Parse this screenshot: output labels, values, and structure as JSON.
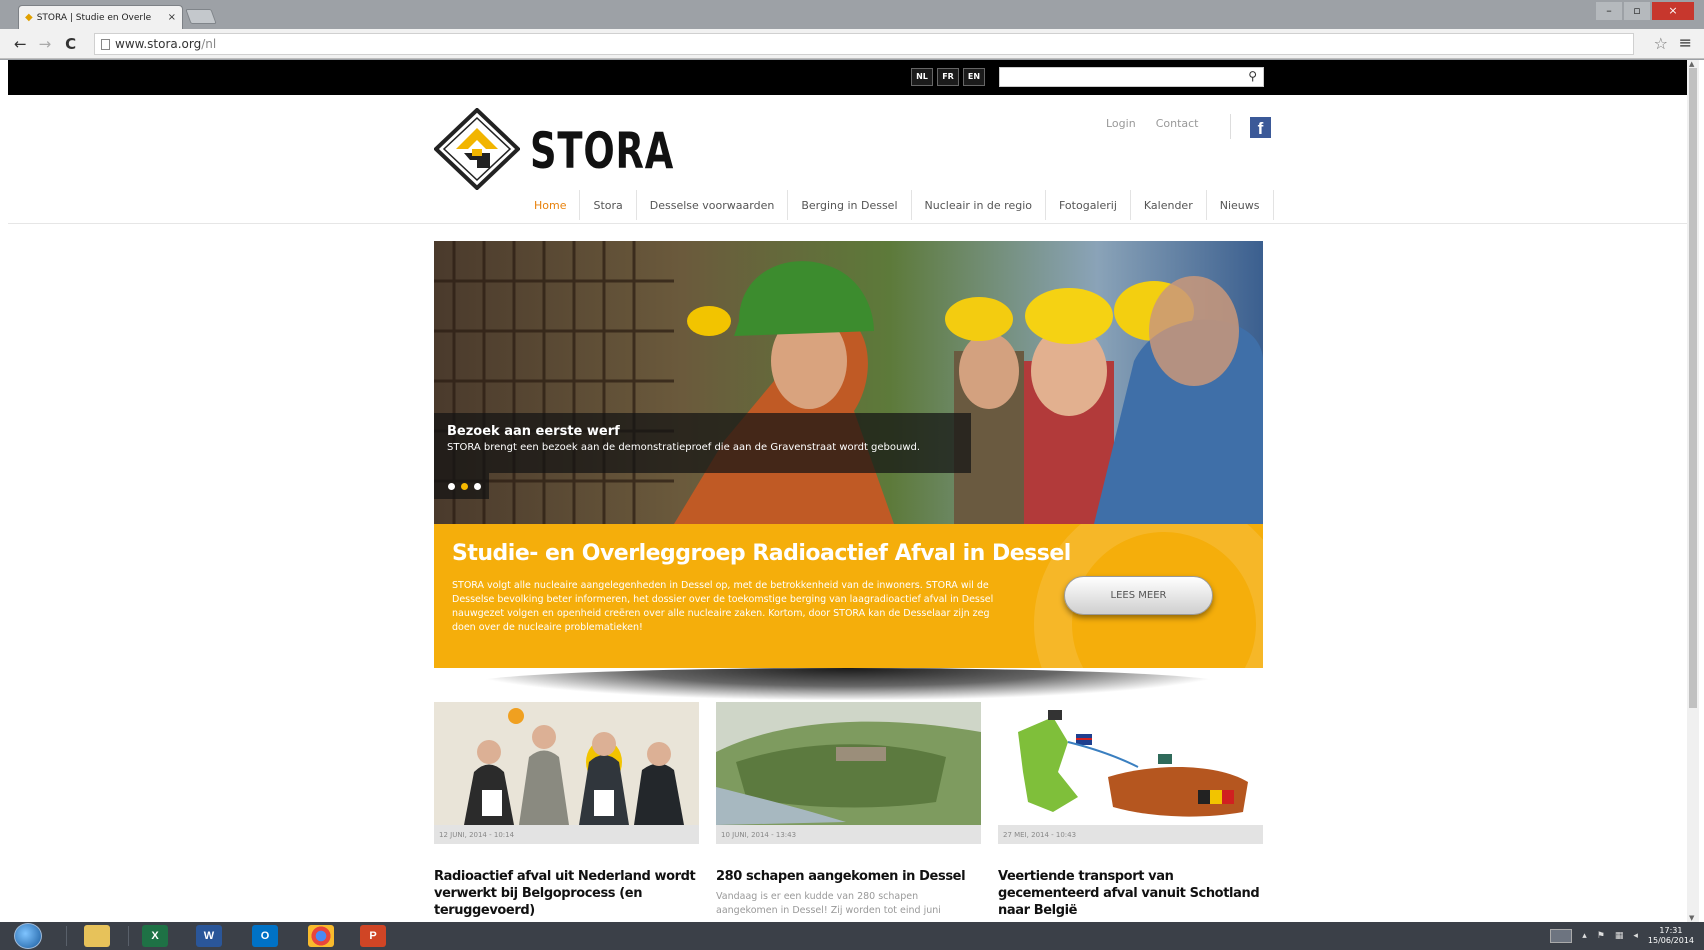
{
  "browser": {
    "tab_title": "STORA | Studie en Overle",
    "tab_close": "×",
    "url_domain": "www.stora.org",
    "url_path": "/nl",
    "back": "←",
    "forward": "→",
    "reload": "C",
    "star": "☆",
    "menu": "≡",
    "win_minimize": "–",
    "win_maximize": "▫",
    "win_close": "×"
  },
  "topbar": {
    "languages": [
      "NL",
      "FR",
      "EN"
    ],
    "search_placeholder": "",
    "search_icon": "search-icon"
  },
  "header": {
    "logo_text": "STORA",
    "util_links": [
      "Login",
      "Contact"
    ],
    "facebook_label": "f",
    "nav": [
      "Home",
      "Stora",
      "Desselse voorwaarden",
      "Berging in Dessel",
      "Nucleair in de regio",
      "Fotogalerij",
      "Kalender",
      "Nieuws"
    ]
  },
  "hero": {
    "caption_title": "Bezoek aan eerste werf",
    "caption_text": "STORA brengt een bezoek aan de demonstratieproef die aan de Gravenstraat wordt gebouwd.",
    "active_dot": 1
  },
  "banner": {
    "title": "Studie- en Overleggroep Radioactief Afval in Dessel",
    "text": "STORA volgt alle nucleaire aangelegenheden in Dessel op, met de betrokkenheid van de inwoners. STORA wil de Desselse bevolking beter informeren, het dossier over de toekomstige berging van laagradioactief afval in Dessel nauwgezet volgen en openheid creëren over alle nucleaire zaken. Kortom, door STORA kan de Desselaar zijn zeg doen over de nucleaire problematieken!",
    "button": "LEES MEER"
  },
  "news": [
    {
      "date": "12 JUNI, 2014 - 10:14",
      "title": "Radioactief afval uit Nederland wordt verwerkt bij Belgoprocess (en teruggevoerd)",
      "excerpt": ""
    },
    {
      "date": "10 JUNI, 2014 - 13:43",
      "title": "280 schapen aangekomen in Dessel",
      "excerpt": "Vandaag is er een kudde van 280 schapen aangekomen in Dessel! Zij worden tot eind juni"
    },
    {
      "date": "27 MEI, 2014 - 10:43",
      "title": "Veertiende transport van gecementeerd afval vanuit Schotland naar België",
      "excerpt": ""
    }
  ],
  "taskbar": {
    "apps": [
      "explorer",
      "excel",
      "word",
      "outlook",
      "chrome",
      "powerpoint"
    ],
    "excel_label": "X",
    "word_label": "W",
    "outlook_label": "O",
    "powerpoint_label": "P",
    "time": "17:31",
    "date": "15/06/2014"
  },
  "colors": {
    "accent_orange": "#f5ae0b",
    "nav_active": "#e8820c",
    "facebook": "#3b5998"
  }
}
